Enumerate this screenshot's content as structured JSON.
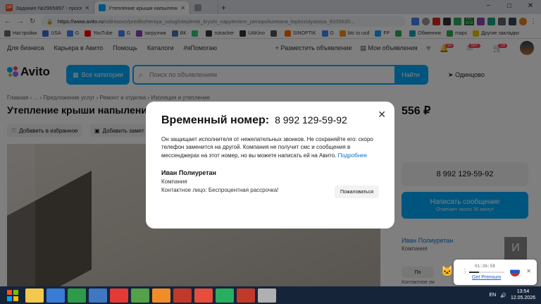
{
  "browser": {
    "tabs": [
      {
        "label": "Задание №2965897 - просмотр з",
        "icon": "sp-icon",
        "favicon_text": "SP",
        "color": "#e8551c"
      },
      {
        "label": "Утепление крыши напылением п",
        "icon": "avito-icon",
        "color": "#00aaff"
      },
      {
        "label": "",
        "icon": "blank-tab-icon",
        "color": "#9aa0a6"
      }
    ],
    "new_tab": "+",
    "win_controls": [
      "−",
      "□",
      "✕"
    ],
    "url": {
      "domain": "https://www.avito.ru",
      "path": "/odintsovo/predlozheniya_uslug/uteplenie_kryshi_napyleniem_penopoliuretana_teploizolyatsiya_8105630..."
    },
    "ext_badges": {
      "ltc": "LTC",
      "num": "57.8"
    },
    "bookmarks": [
      {
        "label": "Настройки",
        "color": "#6b6b6b"
      },
      {
        "label": "USA",
        "color": "#3b6fd6"
      },
      {
        "label": "G",
        "color": "#4285f4"
      },
      {
        "label": "YouTube",
        "color": "#ff0000"
      },
      {
        "label": "G",
        "color": "#4285f4"
      },
      {
        "label": "загрузчик",
        "color": "#8e44ad"
      },
      {
        "label": "ВК",
        "color": "#4a76a8"
      },
      {
        "label": "",
        "color": "#2ecc71"
      },
      {
        "label": "rutracker",
        "color": "#3a3a3a"
      },
      {
        "label": "UAKino",
        "color": "#333333"
      },
      {
        "label": "",
        "color": "#555"
      },
      {
        "label": "SINOPTIK",
        "color": "#ff6a00"
      },
      {
        "label": "G",
        "color": "#4285f4"
      },
      {
        "label": "btc to usd",
        "color": "#f7931a"
      },
      {
        "label": "FP",
        "color": "#1da1f2"
      },
      {
        "label": "",
        "color": "#34a853"
      },
      {
        "label": "Обменник",
        "color": "#17a2b8"
      },
      {
        "label": "maps",
        "color": "#34a853"
      },
      {
        "label": "Другие закладки",
        "color": "#f1c40f"
      }
    ]
  },
  "avito": {
    "topnav": [
      "Для бизнеса",
      "Карьера в Авито",
      "Помощь",
      "Каталоги",
      "#яПомогаю"
    ],
    "post_ad": "Разместить объявление",
    "my_ads": "Мои объявления",
    "badges": [
      "14",
      "99+",
      "14"
    ],
    "logo": "Avito",
    "all_categories": "Все категории",
    "search_placeholder": "Поиск по объявлениям",
    "search_button": "Найти",
    "location": "Одинцово",
    "breadcrumbs": "Главная › ... › Предложение услуг › Ремонт и отделка › Изоляция и утепление",
    "title": "Утепление крыши напылени",
    "price": "556 ₽",
    "favorite": "Добавить в избранное",
    "note": "Добавить замет",
    "phone_button": "8 992 129-59-92",
    "message_button": "Написать сообщение",
    "message_sub": "Отвечает около 30 минут",
    "seller_name": "Иван Полиуретан",
    "seller_type": "Компания",
    "avatar_letter": "И",
    "po": "По",
    "contact_short": "Контактное ли"
  },
  "modal": {
    "heading": "Временный номер:",
    "number": "8 992 129-59-92",
    "description": "Он защищает исполнителя от нежелательных звонков. Не сохраняйте его: скоро телефон заменится на другой. Компания не получит смс и сообщения в мессенджерах на этот номер, но вы можете написать ей на Авито.",
    "more_link": "Подробнее",
    "name": "Иван Полиуретан",
    "company": "Компания",
    "contact": "Контактное лицо: Беспроцентная рассрочка!",
    "report": "Пожаловаться",
    "close": "✕"
  },
  "player": {
    "time": "01:36:58",
    "link": "Get Premium",
    "progress": 0.28
  },
  "taskbar": {
    "apps": [
      {
        "icon": "explorer-icon",
        "color": "#f2c94c"
      },
      {
        "icon": "windows-helper-icon",
        "color": "#3a7bd5"
      },
      {
        "icon": "chrome-icon",
        "color": "#2d9b4a"
      },
      {
        "icon": "network-icon",
        "color": "#3e77c2"
      },
      {
        "icon": "yandex-icon",
        "color": "#e53935"
      },
      {
        "icon": "monitor-icon",
        "color": "#55a04a"
      },
      {
        "icon": "media-player-icon",
        "color": "#f28c28"
      },
      {
        "icon": "aida64-icon",
        "color": "#c0392b"
      },
      {
        "icon": "paint-icon",
        "color": "#e74c3c"
      },
      {
        "icon": "network-monitor-icon",
        "color": "#27ae60"
      },
      {
        "icon": "opera-icon",
        "color": "#c0392b"
      },
      {
        "icon": "folder-icon",
        "color": "#b0b0b0"
      }
    ],
    "lang": "EN",
    "time": "13:54",
    "date": "12.05.2026"
  }
}
